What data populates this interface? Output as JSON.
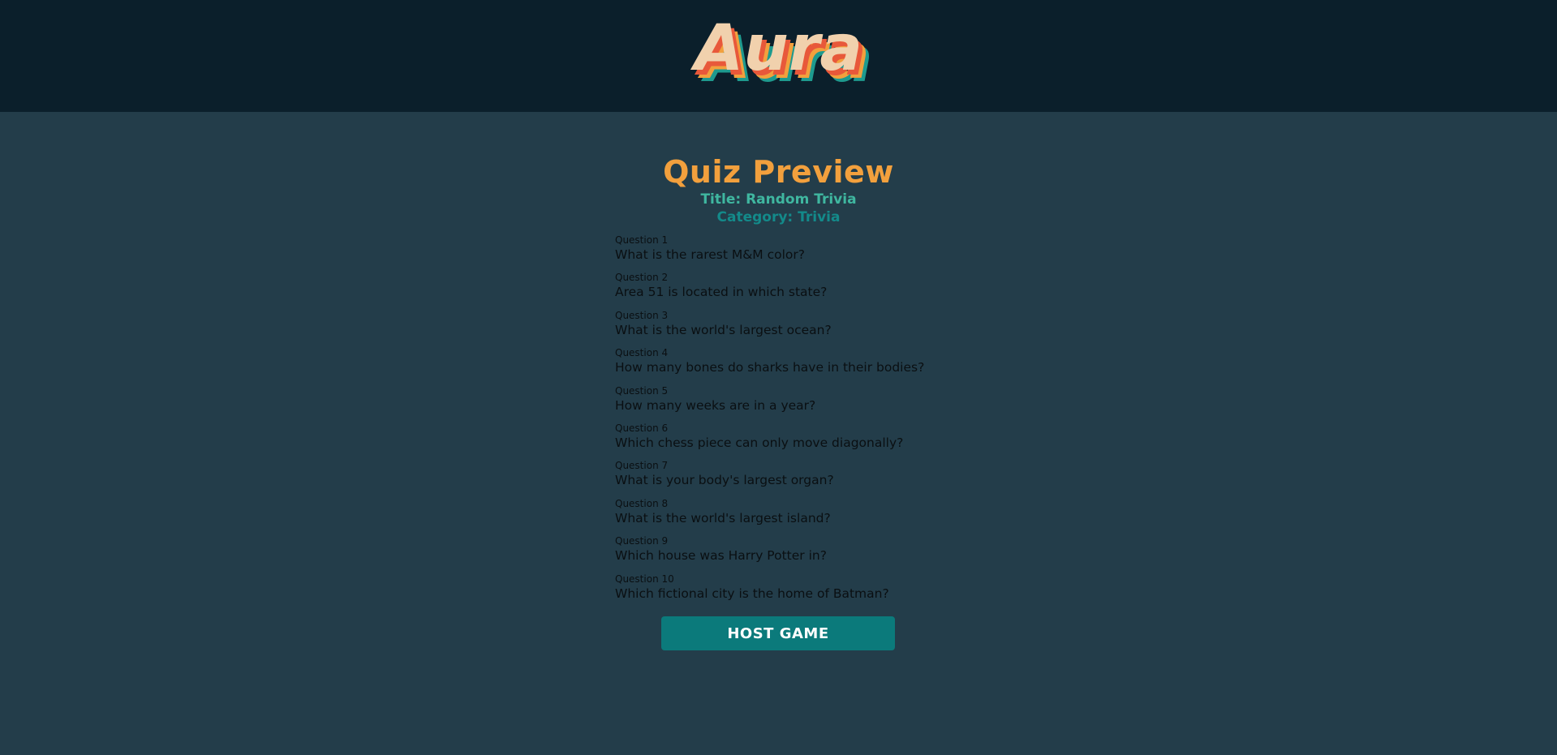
{
  "header": {
    "logo_text": "Aura",
    "colors": {
      "background": "#0b1f2b",
      "logo_face": "#f1d1ad",
      "logo_shadow_1": "#e8583a",
      "logo_shadow_2": "#f2a03d",
      "logo_shadow_3": "#1e9a8e"
    }
  },
  "main": {
    "heading": "Quiz Preview",
    "title_line": "Title: Random Trivia",
    "category_line": "Category: Trivia",
    "questions": [
      {
        "label": "Question 1",
        "text": "What is the rarest M&M color?"
      },
      {
        "label": "Question 2",
        "text": "Area 51 is located in which state?"
      },
      {
        "label": "Question 3",
        "text": "What is the world's largest ocean?"
      },
      {
        "label": "Question 4",
        "text": "How many bones do sharks have in their bodies?"
      },
      {
        "label": "Question 5",
        "text": "How many weeks are in a year?"
      },
      {
        "label": "Question 6",
        "text": "Which chess piece can only move diagonally?"
      },
      {
        "label": "Question 7",
        "text": "What is your body's largest organ?"
      },
      {
        "label": "Question 8",
        "text": "What is the world's largest island?"
      },
      {
        "label": "Question 9",
        "text": "Which house was Harry Potter in?"
      },
      {
        "label": "Question 10",
        "text": "Which fictional city is the home of Batman?"
      }
    ],
    "host_button_label": "HOST GAME",
    "colors": {
      "background": "#233d4a",
      "heading": "#f2a03d",
      "title_line": "#3fb7a0",
      "category_line": "#138a8a",
      "button": "#0b7a7b"
    }
  }
}
